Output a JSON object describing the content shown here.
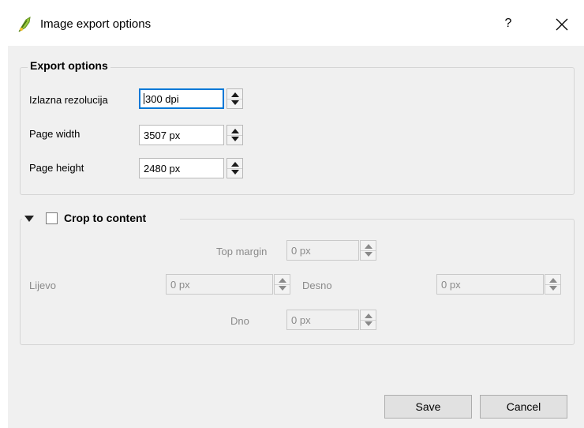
{
  "window": {
    "title": "Image export options",
    "icon": "qgis-icon",
    "help_label": "?",
    "close_icon": "close-icon"
  },
  "export_options": {
    "group_title": "Export options",
    "resolution": {
      "label": "Izlazna rezolucija",
      "value": "300 dpi"
    },
    "page_width": {
      "label": "Page width",
      "value": "3507 px"
    },
    "page_height": {
      "label": "Page height",
      "value": "2480 px"
    }
  },
  "crop": {
    "group_title": "Crop to content",
    "checked": false,
    "collapsed": false,
    "top_margin": {
      "label": "Top margin",
      "value": "0 px"
    },
    "left": {
      "label": "Lijevo",
      "value": "0 px"
    },
    "right": {
      "label": "Desno",
      "value": "0 px"
    },
    "bottom": {
      "label": "Dno",
      "value": "0 px"
    }
  },
  "buttons": {
    "save": "Save",
    "cancel": "Cancel"
  },
  "colors": {
    "focus_border": "#0078d7",
    "dialog_bg": "#f0f0f0",
    "disabled_text": "#8a8a8a"
  }
}
